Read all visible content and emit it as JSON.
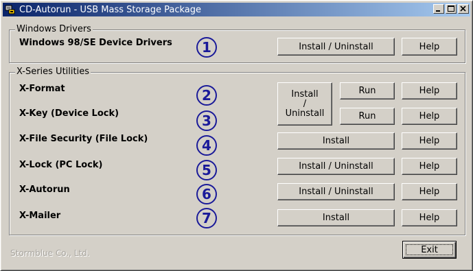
{
  "window": {
    "title": "CD-Autorun - USB Mass Storage Package",
    "icon": "usb-package-icon",
    "controls": {
      "minimize": "minimize-icon",
      "maximize": "maximize-icon",
      "close": "close-icon"
    }
  },
  "windows_drivers": {
    "group_label": "Windows Drivers",
    "items": [
      {
        "label": "Windows 98/SE Device Drivers",
        "number": "1",
        "install": "Install / Uninstall",
        "help": "Help"
      }
    ]
  },
  "xseries": {
    "group_label": "X-Series Utilities",
    "items": [
      {
        "label": "X-Format",
        "number": "2",
        "run": "Run",
        "help": "Help"
      },
      {
        "label": "X-Key (Device Lock)",
        "number": "3",
        "run": "Run",
        "help": "Help"
      },
      {
        "label": "X-File Security (File Lock)",
        "number": "4",
        "install": "Install",
        "help": "Help"
      },
      {
        "label": "X-Lock (PC Lock)",
        "number": "5",
        "install": "Install / Uninstall",
        "help": "Help"
      },
      {
        "label": "X-Autorun",
        "number": "6",
        "install": "Install / Uninstall",
        "help": "Help"
      },
      {
        "label": "X-Mailer",
        "number": "7",
        "install": "Install",
        "help": "Help"
      }
    ],
    "shared_install": "Install\n/\nUninstall"
  },
  "footer": {
    "company": "Stormblue Co., Ltd.",
    "exit": "Exit"
  },
  "colors": {
    "titlebar_start": "#0a246a",
    "titlebar_end": "#a6caf0",
    "number_circle": "#1a1a99",
    "face": "#d4d0c8"
  }
}
